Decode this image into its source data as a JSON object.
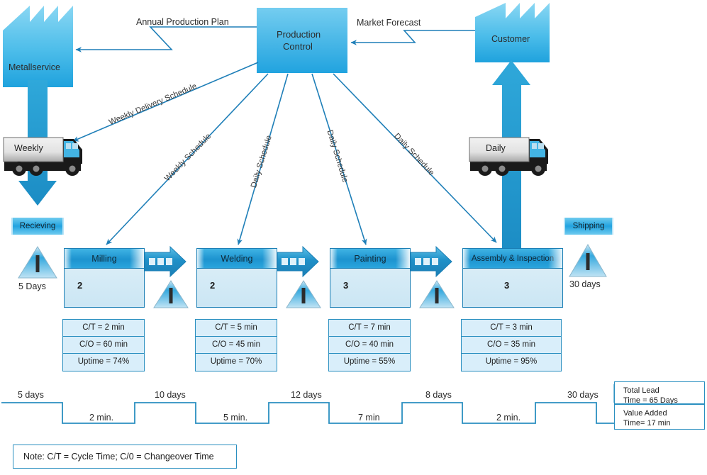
{
  "title": "Value Stream Map",
  "colors": {
    "line": "#1f7fb8",
    "arrow_fill": "#1f90c8",
    "header_blue": "#1d93cf",
    "box_fill": "#d9eefa",
    "factory_top": "#7fd2f0",
    "factory_bottom": "#2aa8e0",
    "text": "#231f20"
  },
  "suppliers": {
    "supplier": {
      "name": "Metallservice"
    },
    "customer": {
      "name": "Customer"
    }
  },
  "control": {
    "name": "Production\nControl",
    "line1": "Production",
    "line2": "Control"
  },
  "info_flows": [
    {
      "label": "Annual Production Plan"
    },
    {
      "label": "Market Forecast"
    },
    {
      "label": "Weekly Delivery Schedule"
    },
    {
      "label": "Weekly Schedule"
    },
    {
      "label": "Daily Schedule"
    },
    {
      "label": "Daily Schedule"
    },
    {
      "label": "Daily Schedule"
    }
  ],
  "trucks": [
    {
      "label": "Weekly"
    },
    {
      "label": "Daily"
    }
  ],
  "terminals": {
    "receiving": "Recieving",
    "shipping": "Shipping"
  },
  "inventories": [
    {
      "label": "5 Days"
    },
    {
      "label": ""
    },
    {
      "label": ""
    },
    {
      "label": ""
    },
    {
      "label": "30 days"
    }
  ],
  "processes": [
    {
      "name": "Milling",
      "operators": "2",
      "metrics": [
        "C/T = 2 min",
        "C/O = 60 min",
        "Uptime = 74%"
      ]
    },
    {
      "name": "Welding",
      "operators": "2",
      "metrics": [
        "C/T = 5 min",
        "C/O = 45 min",
        "Uptime = 70%"
      ]
    },
    {
      "name": "Painting",
      "operators": "3",
      "metrics": [
        "C/T = 7 min",
        "C/O = 40 min",
        "Uptime = 55%"
      ]
    },
    {
      "name": "Assembly & Inspection",
      "operators": "3",
      "metrics": [
        "C/T = 3 min",
        "C/O = 35 min",
        "Uptime = 95%"
      ]
    }
  ],
  "timeline": {
    "lead_times": [
      "5 days",
      "10 days",
      "12 days",
      "8 days",
      "30 days"
    ],
    "process_times": [
      "2 min.",
      "5 min.",
      "7 min",
      "2 min."
    ]
  },
  "summary": {
    "lead_line1": "Total Lead",
    "lead_line2": "Time = 65 Days",
    "value_line1": "Value Added",
    "value_line2": "Time= 17 min"
  },
  "note": "Note: C/T = Cycle Time; C/0 = Changeover Time"
}
